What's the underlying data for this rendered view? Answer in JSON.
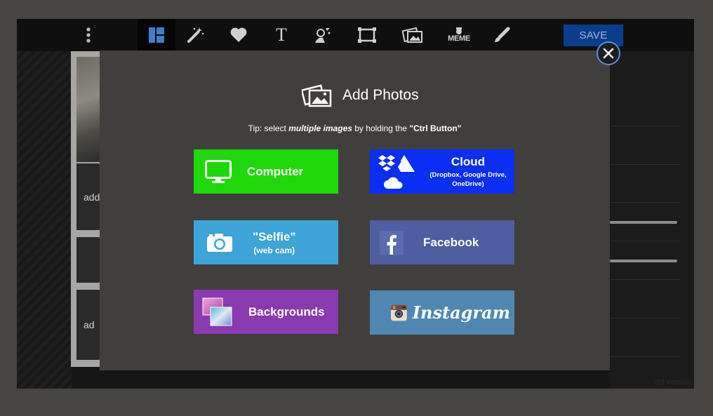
{
  "toolbar": {
    "tools": [
      "menu-dots-icon",
      "layout-icon",
      "magic-wand-icon",
      "heart-icon",
      "text-icon",
      "sticker-icon",
      "frame-icon",
      "photo-icon",
      "meme-icon",
      "brush-icon"
    ],
    "meme_label": "MEME",
    "text_glyph": "T",
    "save_label": "SAVE"
  },
  "canvas": {
    "slot_label_1": "add",
    "slot_label_2": "ad"
  },
  "footer": {
    "old_version": "old version"
  },
  "modal": {
    "title": "Add Photos",
    "tip": {
      "prefix": "Tip: select ",
      "emphasis": "multiple images",
      "middle": " by holding the ",
      "key": "\"Ctrl Button\""
    },
    "buttons": {
      "computer": {
        "label": "Computer",
        "color": "#1fd80c"
      },
      "cloud": {
        "label": "Cloud",
        "sub": "(Dropbox, Google Drive, OneDrive)",
        "color": "#0b2ef3"
      },
      "selfie": {
        "label": "\"Selfie\"",
        "sub": "(web cam)",
        "color": "#3ea3d6"
      },
      "facebook": {
        "label": "Facebook",
        "color": "#4e5ea0"
      },
      "backgrounds": {
        "label": "Backgrounds",
        "color": "#8a3ab1"
      },
      "instagram": {
        "label": "Instagram",
        "color": "#5086b2"
      }
    },
    "close_icon": "close-icon"
  }
}
